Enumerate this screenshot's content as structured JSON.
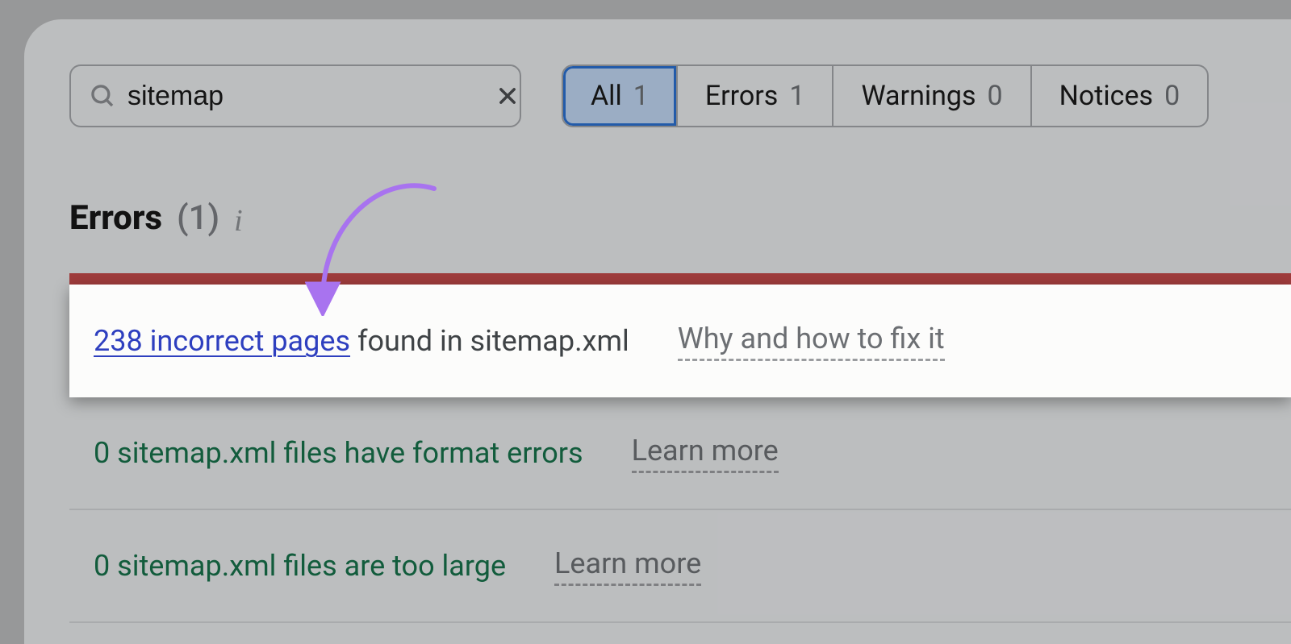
{
  "search": {
    "value": "sitemap"
  },
  "filters": {
    "all": {
      "label": "All",
      "count": 1
    },
    "errors": {
      "label": "Errors",
      "count": 1
    },
    "warnings": {
      "label": "Warnings",
      "count": 0
    },
    "notices": {
      "label": "Notices",
      "count": 0
    }
  },
  "section": {
    "title": "Errors",
    "count_display": "(1)"
  },
  "issues": [
    {
      "link_text": "238 incorrect pages",
      "suffix": " found in sitemap.xml",
      "help": "Why and how to fix it",
      "highlighted": true
    },
    {
      "text": "0 sitemap.xml files have format errors",
      "help": "Learn more"
    },
    {
      "text": "0 sitemap.xml files are too large",
      "help": "Learn more"
    }
  ]
}
